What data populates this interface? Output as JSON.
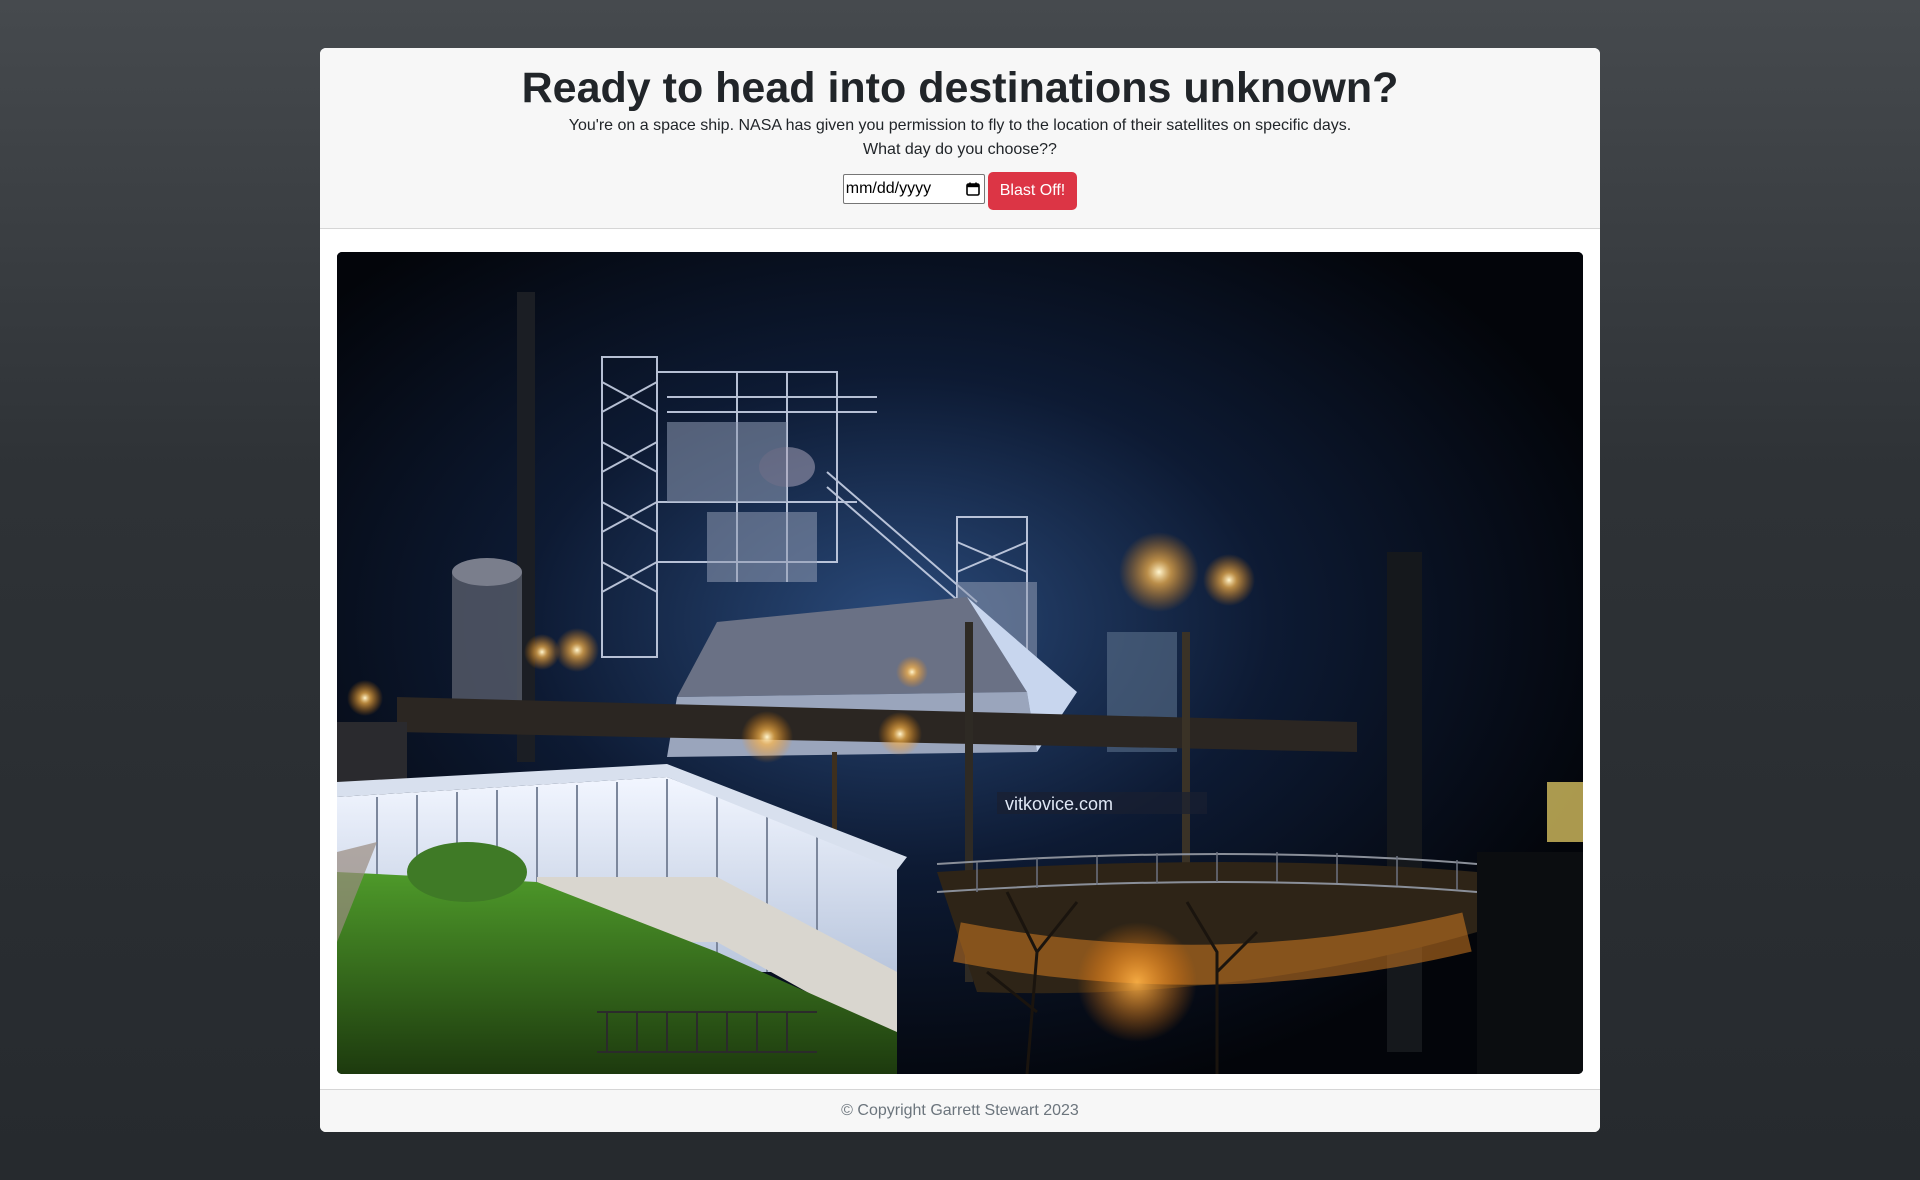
{
  "header": {
    "title": "Ready to head into destinations unknown?",
    "subtitle_line1": "You're on a space ship. NASA has given you permission to fly to the location of their satellites on specific days.",
    "subtitle_line2": "What day do you choose??"
  },
  "form": {
    "date_placeholder": "mm/dd/yyyy",
    "submit_label": "Blast Off!",
    "calendar_icon": "calendar-icon"
  },
  "photo": {
    "watermark": "vitkovice.com"
  },
  "footer": {
    "copyright": "© Copyright Garrett Stewart 2023"
  },
  "colors": {
    "accent_button": "#dc3545",
    "card_header_bg": "#f7f7f7",
    "page_bg": "#2e3236"
  }
}
